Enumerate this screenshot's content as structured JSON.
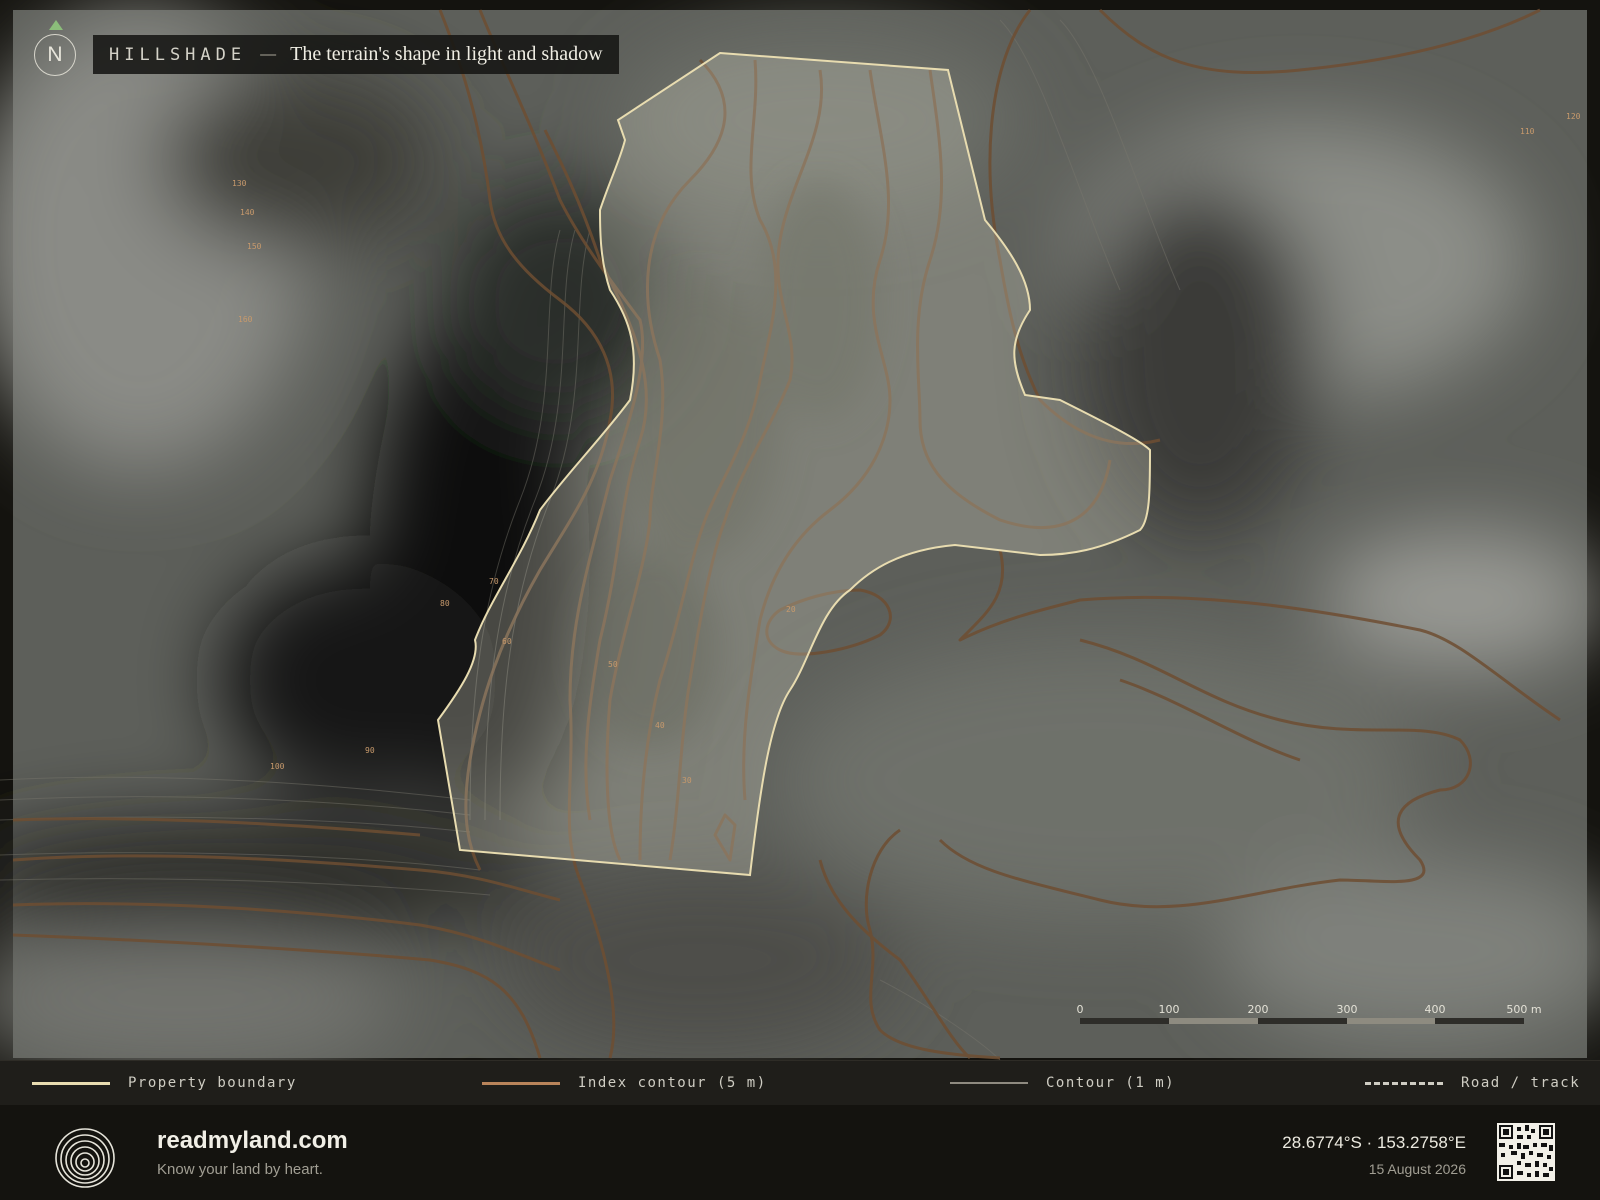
{
  "title": {
    "kicker": "HILLSHADE",
    "dash": "—",
    "subtitle": "The terrain's shape in light and shadow"
  },
  "north_label": "N",
  "contour_labels": [
    "130",
    "140",
    "150",
    "160",
    "110",
    "120",
    "70",
    "80",
    "60",
    "50",
    "40",
    "30",
    "20",
    "90",
    "100"
  ],
  "scale_bar": {
    "labels": [
      "0",
      "100",
      "200",
      "300",
      "400",
      "500 m"
    ]
  },
  "legend": [
    {
      "label": "Property boundary",
      "color": "#e8dcb0",
      "style": "solid"
    },
    {
      "label": "Index contour (5 m)",
      "color": "#b9845a",
      "style": "solid"
    },
    {
      "label": "Contour (1 m)",
      "color": "#8e8a80",
      "style": "solid"
    },
    {
      "label": "Road / track",
      "color": "#cfcdc3",
      "style": "dashed"
    }
  ],
  "footer": {
    "brand": "readmyland.com",
    "tagline": "Know your land by heart.",
    "coords": "28.6774°S · 153.2758°E",
    "date": "15 August 2026"
  },
  "colors": {
    "boundary": "#e8dcb0",
    "index_contour": "#6e4e32",
    "minor_contour": "#5c5a52",
    "label": "#c89a6c"
  }
}
